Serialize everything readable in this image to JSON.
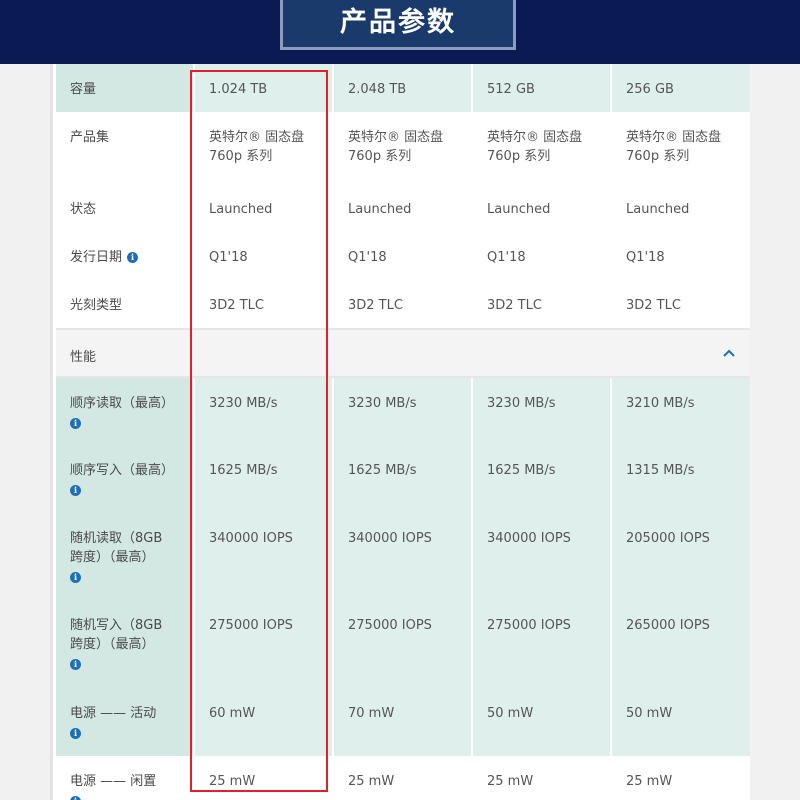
{
  "page_title": "产品参数",
  "section": {
    "label": "性能"
  },
  "colors": {
    "banner": "#0b1a52",
    "title_box": "#1b3a6c",
    "row_tint": "#dff0ec",
    "highlight": "#e0202a",
    "info_icon": "#1f6fb5"
  },
  "icons": {
    "info": "info-icon",
    "collapse": "chevron-up-icon"
  },
  "top_rows": [
    {
      "label": "容量",
      "info": false,
      "values": [
        "1.024 TB",
        "2.048 TB",
        "512 GB",
        "256 GB"
      ]
    },
    {
      "label": "产品集",
      "info": false,
      "values": [
        "英特尔® 固态盘\n760p 系列",
        "英特尔® 固态盘\n760p 系列",
        "英特尔® 固态盘\n760p 系列",
        "英特尔® 固态盘\n760p 系列"
      ]
    },
    {
      "label": "状态",
      "info": false,
      "values": [
        "Launched",
        "Launched",
        "Launched",
        "Launched"
      ]
    },
    {
      "label": "发行日期",
      "info": true,
      "values": [
        "Q1'18",
        "Q1'18",
        "Q1'18",
        "Q1'18"
      ]
    },
    {
      "label": "光刻类型",
      "info": false,
      "values": [
        "3D2 TLC",
        "3D2 TLC",
        "3D2 TLC",
        "3D2 TLC"
      ]
    }
  ],
  "perf_rows": [
    {
      "label": "顺序读取（最高）",
      "info": true,
      "values": [
        "3230 MB/s",
        "3230 MB/s",
        "3230 MB/s",
        "3210 MB/s"
      ]
    },
    {
      "label": "顺序写入（最高）",
      "info": true,
      "values": [
        "1625 MB/s",
        "1625 MB/s",
        "1625 MB/s",
        "1315 MB/s"
      ]
    },
    {
      "label": "随机读取（8GB\n跨度）（最高）",
      "info": true,
      "values": [
        "340000 IOPS",
        "340000 IOPS",
        "340000 IOPS",
        "205000 IOPS"
      ]
    },
    {
      "label": "随机写入（8GB\n跨度）（最高）",
      "info": true,
      "values": [
        "275000 IOPS",
        "275000 IOPS",
        "275000 IOPS",
        "265000 IOPS"
      ]
    },
    {
      "label": "电源 —— 活动",
      "info": true,
      "values": [
        "60 mW",
        "70 mW",
        "50 mW",
        "50 mW"
      ]
    },
    {
      "label": "电源 —— 闲置",
      "info": true,
      "values": [
        "25 mW",
        "25 mW",
        "25 mW",
        "25 mW"
      ]
    }
  ]
}
